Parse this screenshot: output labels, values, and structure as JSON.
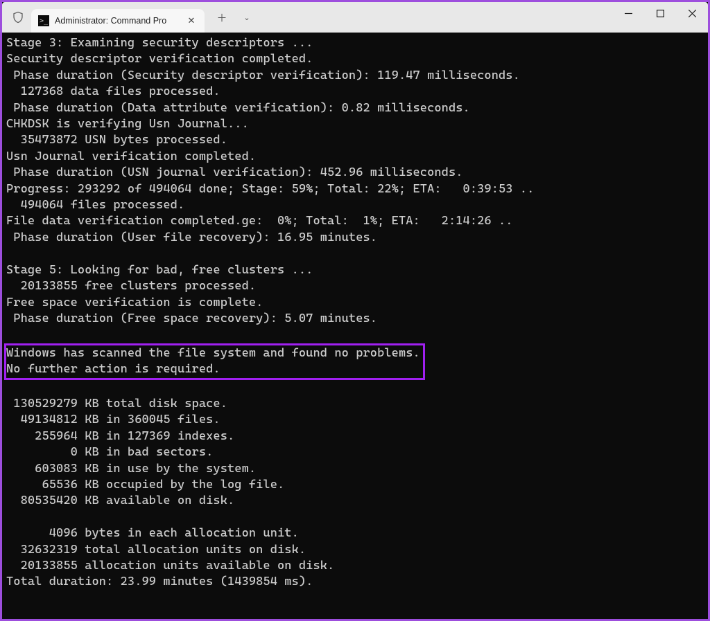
{
  "window": {
    "tab_title": "Administrator: Command Pro",
    "tab_icon_glyph": ">_"
  },
  "icons": {
    "close": "✕",
    "plus": "＋",
    "chevron": "⌄",
    "minimize": "—",
    "maximize": "▢",
    "win_close": "✕"
  },
  "terminal": {
    "lines": [
      "Stage 3: Examining security descriptors ...",
      "Security descriptor verification completed.",
      " Phase duration (Security descriptor verification): 119.47 milliseconds.",
      "  127368 data files processed.",
      " Phase duration (Data attribute verification): 0.82 milliseconds.",
      "CHKDSK is verifying Usn Journal...",
      "  35473872 USN bytes processed.",
      "Usn Journal verification completed.",
      " Phase duration (USN journal verification): 452.96 milliseconds.",
      "Progress: 293292 of 494064 done; Stage: 59%; Total: 22%; ETA:   0:39:53 ..",
      "  494064 files processed.",
      "File data verification completed.ge:  0%; Total:  1%; ETA:   2:14:26 ..",
      " Phase duration (User file recovery): 16.95 minutes.",
      "",
      "Stage 5: Looking for bad, free clusters ...",
      "  20133855 free clusters processed.",
      "Free space verification is complete.",
      " Phase duration (Free space recovery): 5.07 minutes.",
      ""
    ],
    "highlight": [
      "Windows has scanned the file system and found no problems.",
      "No further action is required."
    ],
    "lines_after": [
      "",
      " 130529279 KB total disk space.",
      "  49134812 KB in 360045 files.",
      "    255964 KB in 127369 indexes.",
      "         0 KB in bad sectors.",
      "    603083 KB in use by the system.",
      "     65536 KB occupied by the log file.",
      "  80535420 KB available on disk.",
      "",
      "      4096 bytes in each allocation unit.",
      "  32632319 total allocation units on disk.",
      "  20133855 allocation units available on disk.",
      "Total duration: 23.99 minutes (1439854 ms)."
    ]
  },
  "colors": {
    "frame_border": "#9d4edd",
    "highlight_border": "#a020f0",
    "terminal_bg": "#0c0c0c",
    "terminal_fg": "#cccccc",
    "titlebar_bg": "#e8e8e8",
    "tab_bg": "#f7f7f7"
  }
}
